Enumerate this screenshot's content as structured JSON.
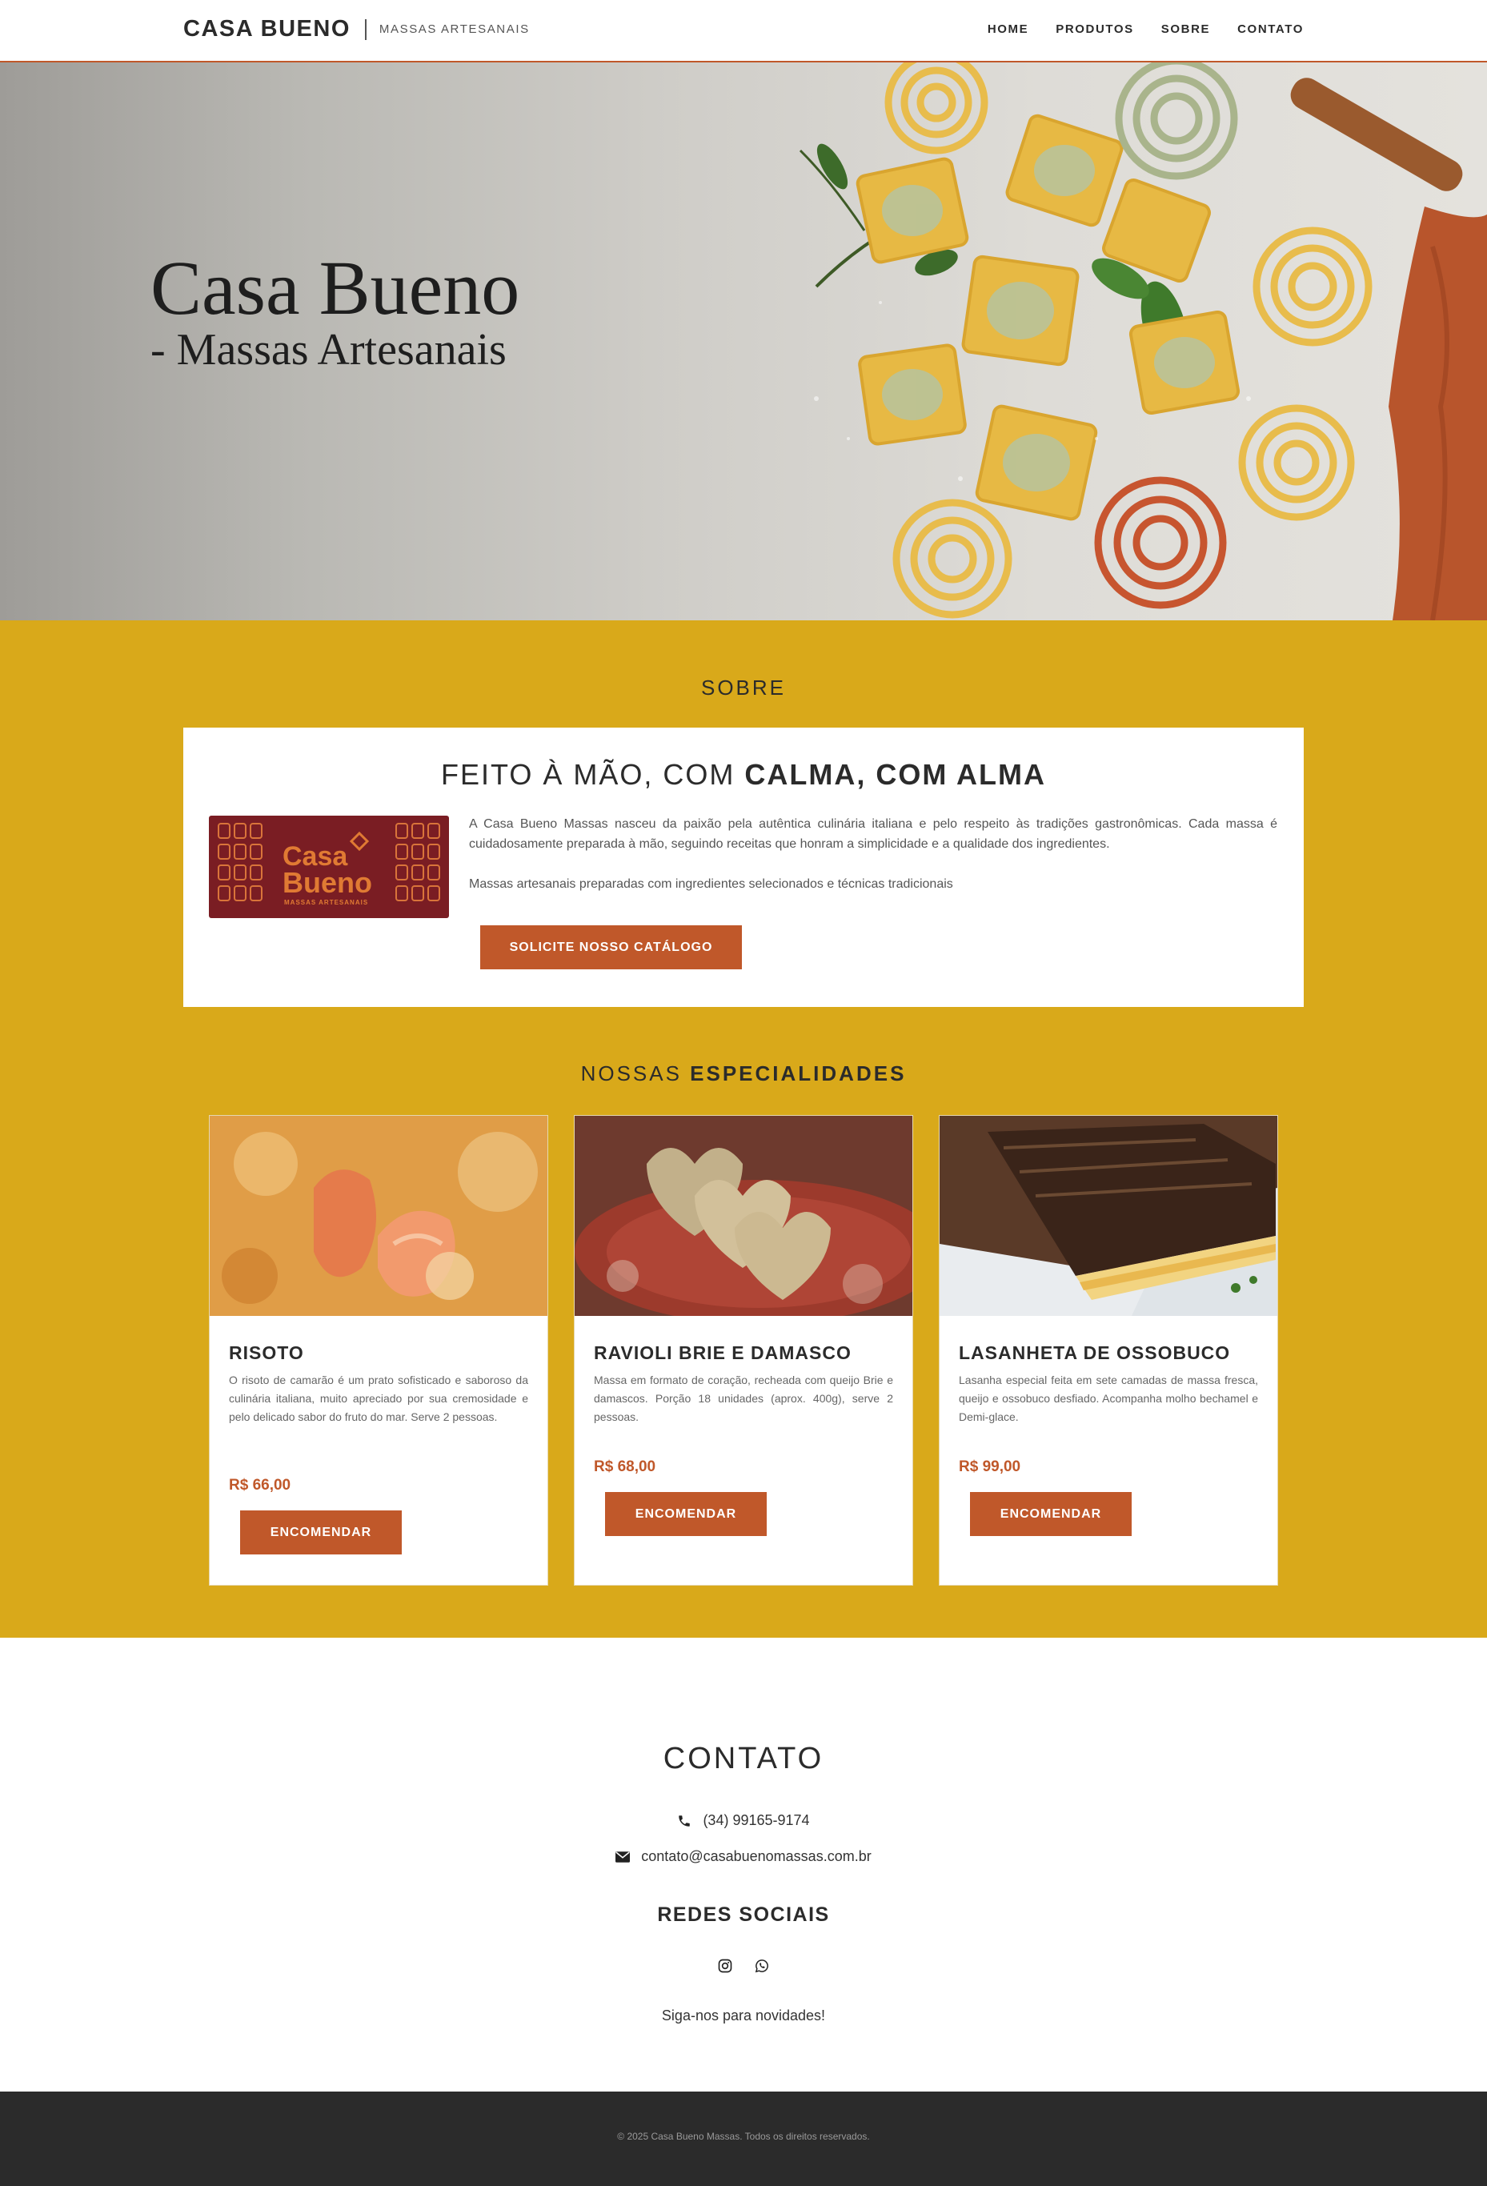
{
  "header": {
    "brand": "CASA BUENO",
    "tagline": "MASSAS ARTESANAIS",
    "nav": [
      "HOME",
      "PRODUTOS",
      "SOBRE",
      "CONTATO"
    ]
  },
  "hero": {
    "title": "Casa Bueno",
    "subtitle": "- Massas Artesanais"
  },
  "about": {
    "section_label": "SOBRE",
    "heading_light": "FEITO À MÃO, COM ",
    "heading_bold": "CALMA, COM ALMA",
    "logo_text_1": "Casa",
    "logo_text_2": "Bueno",
    "logo_sub": "MASSAS ARTESANAIS",
    "paragraph_1": "A Casa Bueno Massas nasceu da paixão pela autêntica culinária italiana e pelo respeito às tradições gastronômicas. Cada massa é cuidadosamente preparada à mão, seguindo receitas que honram a simplicidade e a qualidade dos ingredientes.",
    "paragraph_2": "Massas artesanais preparadas com ingredientes selecionados e técnicas tradicionais",
    "catalog_button": "SOLICITE NOSSO CATÁLOGO"
  },
  "specialties": {
    "label_light": "NOSSAS ",
    "label_bold": "ESPECIALIDADES",
    "items": [
      {
        "title": "RISOTO",
        "description": "O risoto de camarão é um prato sofisticado e saboroso da culinária italiana, muito apreciado por sua cremosidade e pelo delicado sabor do fruto do mar. Serve 2 pessoas.",
        "price": "R$ 66,00",
        "button": "ENCOMENDAR"
      },
      {
        "title": "RAVIOLI BRIE E DAMASCO",
        "description": "Massa em formato de coração, recheada com queijo Brie e damascos. Porção 18 unidades (aprox. 400g), serve 2 pessoas.",
        "price": "R$ 68,00",
        "button": "ENCOMENDAR"
      },
      {
        "title": "LASANHETA DE OSSOBUCO",
        "description": "Lasanha especial feita em sete camadas de massa fresca, queijo e ossobuco desfiado. Acompanha molho bechamel e Demi-glace.",
        "price": "R$ 99,00",
        "button": "ENCOMENDAR"
      }
    ]
  },
  "contact": {
    "title": "CONTATO",
    "phone": "(34) 99165-9174",
    "email": "contato@casabuenomassas.com.br",
    "social_title": "REDES SOCIAIS",
    "social_icons": [
      "instagram-icon",
      "whatsapp-icon"
    ],
    "follow_text": "Siga-nos para novidades!"
  },
  "footer": {
    "copyright": "© 2025 Casa Bueno Massas. Todos os direitos reservados."
  },
  "colors": {
    "accent": "#c0582a",
    "section_bg": "#d9a91a",
    "footer_bg": "#2b2b2b",
    "logo_bg": "#7a1d23"
  }
}
